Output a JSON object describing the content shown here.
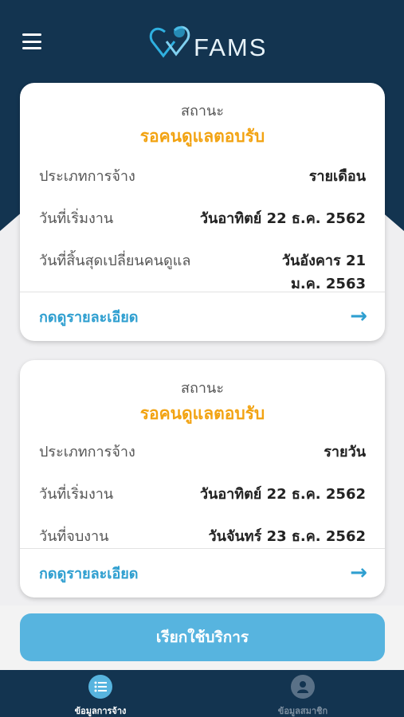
{
  "header": {
    "menu_icon": "hamburger-icon",
    "logo_text": "FAMS",
    "colors": {
      "navy": "#133450",
      "accent": "#2f9fd0"
    }
  },
  "cards": [
    {
      "status_label": "สถานะ",
      "status_value": "รอคนดูแลตอบรับ",
      "rows": [
        {
          "label": "ประเภทการจ้าง",
          "value": "รายเดือน"
        },
        {
          "label": "วันที่เริ่มงาน",
          "value": "วันอาทิตย์ 22 ธ.ค. 2562"
        },
        {
          "label": "วันที่สิ้นสุดเปลี่ยนคนดูแล",
          "value_line1": "วันอังคาร 21",
          "value_line2": "ม.ค. 2563"
        }
      ],
      "detail_label": "กดดูรายละเอียด",
      "detail_icon": "arrow-right-icon"
    },
    {
      "status_label": "สถานะ",
      "status_value": "รอคนดูแลตอบรับ",
      "rows": [
        {
          "label": "ประเภทการจ้าง",
          "value": "รายวัน"
        },
        {
          "label": "วันที่เริ่มงาน",
          "value": "วันอาทิตย์ 22 ธ.ค. 2562"
        },
        {
          "label": "วันที่จบงาน",
          "value": "วันจันทร์ 23 ธ.ค. 2562"
        }
      ],
      "detail_label": "กดดูรายละเอียด",
      "detail_icon": "arrow-right-icon"
    }
  ],
  "cta": {
    "label": "เรียกใช้บริการ"
  },
  "tabs": [
    {
      "label": "ข้อมูลการจ้าง",
      "icon": "list-icon",
      "active": true
    },
    {
      "label": "ข้อมูลสมาชิก",
      "icon": "user-icon",
      "active": false
    }
  ]
}
